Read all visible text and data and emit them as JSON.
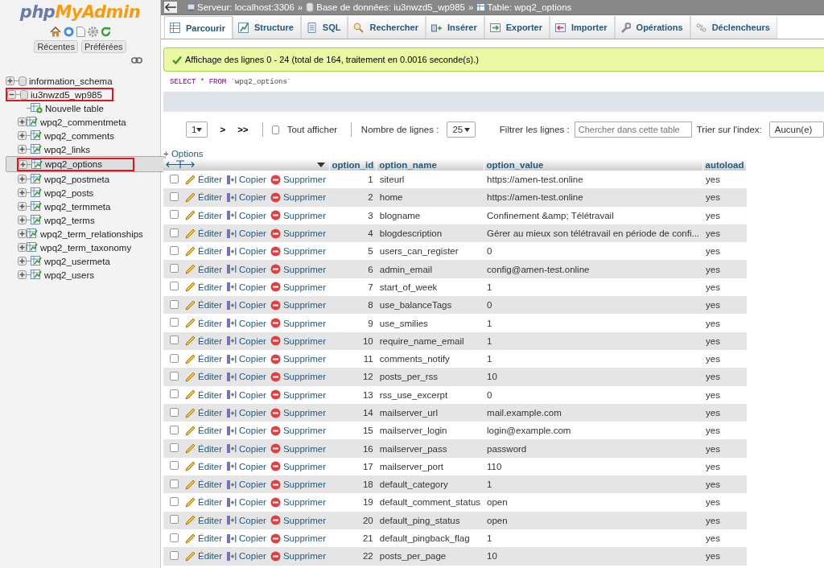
{
  "logo": {
    "part1": "php",
    "part2": "MyAdmin"
  },
  "sidebar_tabs": [
    "Récentes",
    "Préférées"
  ],
  "tree": [
    {
      "label": "information_schema",
      "kind": "database",
      "expanded": false,
      "selected": false,
      "highlighted": false
    },
    {
      "label": "iu3nwzd5_wp985",
      "kind": "database",
      "expanded": true,
      "selected": false,
      "highlighted": true,
      "children": [
        {
          "label": "Nouvelle table",
          "kind": "new",
          "selected": false,
          "highlighted": false
        },
        {
          "label": "wpq2_commentmeta",
          "kind": "table",
          "selected": false,
          "highlighted": false
        },
        {
          "label": "wpq2_comments",
          "kind": "table",
          "selected": false,
          "highlighted": false
        },
        {
          "label": "wpq2_links",
          "kind": "table",
          "selected": false,
          "highlighted": false
        },
        {
          "label": "wpq2_options",
          "kind": "table",
          "selected": true,
          "highlighted": true
        },
        {
          "label": "wpq2_postmeta",
          "kind": "table",
          "selected": false,
          "highlighted": false
        },
        {
          "label": "wpq2_posts",
          "kind": "table",
          "selected": false,
          "highlighted": false
        },
        {
          "label": "wpq2_termmeta",
          "kind": "table",
          "selected": false,
          "highlighted": false
        },
        {
          "label": "wpq2_terms",
          "kind": "table",
          "selected": false,
          "highlighted": false
        },
        {
          "label": "wpq2_term_relationships",
          "kind": "table",
          "selected": false,
          "highlighted": false
        },
        {
          "label": "wpq2_term_taxonomy",
          "kind": "table",
          "selected": false,
          "highlighted": false
        },
        {
          "label": "wpq2_usermeta",
          "kind": "table",
          "selected": false,
          "highlighted": false
        },
        {
          "label": "wpq2_users",
          "kind": "table",
          "selected": false,
          "highlighted": false
        }
      ]
    }
  ],
  "breadcrumb": [
    {
      "kind": "server",
      "label": "Serveur: localhost:3306"
    },
    {
      "kind": "database",
      "separator": "»",
      "label": "Base de données: iu3nwzd5_wp985"
    },
    {
      "kind": "table",
      "separator": "»",
      "label": "Table: wpq2_options"
    }
  ],
  "tabs": [
    {
      "kind": "browse",
      "label": "Parcourir",
      "selected": true
    },
    {
      "kind": "structure",
      "label": "Structure",
      "selected": false
    },
    {
      "kind": "sql",
      "label": "SQL",
      "selected": false
    },
    {
      "kind": "search",
      "label": "Rechercher",
      "selected": false
    },
    {
      "kind": "insert",
      "label": "Insérer",
      "selected": false
    },
    {
      "kind": "export",
      "label": "Exporter",
      "selected": false
    },
    {
      "kind": "import",
      "label": "Importer",
      "selected": false
    },
    {
      "kind": "operations",
      "label": "Opérations",
      "selected": false
    },
    {
      "kind": "triggers",
      "label": "Déclencheurs",
      "selected": false
    }
  ],
  "message": "Affichage des lignes 0 - 24 (total de 164, traitement en 0.0016 seconde(s).)",
  "query": {
    "keyword1": "SELECT",
    "star": "*",
    "keyword2": "FROM",
    "table": "`wpq2_options`"
  },
  "nav": {
    "page": "1",
    "next": ">",
    "last": ">>",
    "show_all": {
      "label": "Tout afficher",
      "checked": false
    },
    "rows_label": "Nombre de lignes :",
    "rows_value": "25",
    "filter_label": "Filtrer les lignes :",
    "filter_placeholder": "Chercher dans cette table",
    "sort_label": "Trier sur l'index:",
    "sort_value": "Aucun(e)"
  },
  "options_link": "+ Options",
  "columns": [
    "option_id",
    "option_name",
    "option_value",
    "autoload"
  ],
  "rows": [
    {
      "checked": false,
      "actions": [
        "Éditer",
        "Copier",
        "Supprimer"
      ],
      "cells": [
        "1",
        "siteurl",
        "https://amen-test.online",
        "yes"
      ]
    },
    {
      "checked": false,
      "actions": [
        "Éditer",
        "Copier",
        "Supprimer"
      ],
      "cells": [
        "2",
        "home",
        "https://amen-test.online",
        "yes"
      ]
    },
    {
      "checked": false,
      "actions": [
        "Éditer",
        "Copier",
        "Supprimer"
      ],
      "cells": [
        "3",
        "blogname",
        "Confinement &amp; Télétravail",
        "yes"
      ]
    },
    {
      "checked": false,
      "actions": [
        "Éditer",
        "Copier",
        "Supprimer"
      ],
      "cells": [
        "4",
        "blogdescription",
        "Gérer au mieux son télétravail en période de confi...",
        "yes"
      ]
    },
    {
      "checked": false,
      "actions": [
        "Éditer",
        "Copier",
        "Supprimer"
      ],
      "cells": [
        "5",
        "users_can_register",
        "0",
        "yes"
      ]
    },
    {
      "checked": false,
      "actions": [
        "Éditer",
        "Copier",
        "Supprimer"
      ],
      "cells": [
        "6",
        "admin_email",
        "config@amen-test.online",
        "yes"
      ]
    },
    {
      "checked": false,
      "actions": [
        "Éditer",
        "Copier",
        "Supprimer"
      ],
      "cells": [
        "7",
        "start_of_week",
        "1",
        "yes"
      ]
    },
    {
      "checked": false,
      "actions": [
        "Éditer",
        "Copier",
        "Supprimer"
      ],
      "cells": [
        "8",
        "use_balanceTags",
        "0",
        "yes"
      ]
    },
    {
      "checked": false,
      "actions": [
        "Éditer",
        "Copier",
        "Supprimer"
      ],
      "cells": [
        "9",
        "use_smilies",
        "1",
        "yes"
      ]
    },
    {
      "checked": false,
      "actions": [
        "Éditer",
        "Copier",
        "Supprimer"
      ],
      "cells": [
        "10",
        "require_name_email",
        "1",
        "yes"
      ]
    },
    {
      "checked": false,
      "actions": [
        "Éditer",
        "Copier",
        "Supprimer"
      ],
      "cells": [
        "11",
        "comments_notify",
        "1",
        "yes"
      ]
    },
    {
      "checked": false,
      "actions": [
        "Éditer",
        "Copier",
        "Supprimer"
      ],
      "cells": [
        "12",
        "posts_per_rss",
        "10",
        "yes"
      ]
    },
    {
      "checked": false,
      "actions": [
        "Éditer",
        "Copier",
        "Supprimer"
      ],
      "cells": [
        "13",
        "rss_use_excerpt",
        "0",
        "yes"
      ]
    },
    {
      "checked": false,
      "actions": [
        "Éditer",
        "Copier",
        "Supprimer"
      ],
      "cells": [
        "14",
        "mailserver_url",
        "mail.example.com",
        "yes"
      ]
    },
    {
      "checked": false,
      "actions": [
        "Éditer",
        "Copier",
        "Supprimer"
      ],
      "cells": [
        "15",
        "mailserver_login",
        "login@example.com",
        "yes"
      ]
    },
    {
      "checked": false,
      "actions": [
        "Éditer",
        "Copier",
        "Supprimer"
      ],
      "cells": [
        "16",
        "mailserver_pass",
        "password",
        "yes"
      ]
    },
    {
      "checked": false,
      "actions": [
        "Éditer",
        "Copier",
        "Supprimer"
      ],
      "cells": [
        "17",
        "mailserver_port",
        "110",
        "yes"
      ]
    },
    {
      "checked": false,
      "actions": [
        "Éditer",
        "Copier",
        "Supprimer"
      ],
      "cells": [
        "18",
        "default_category",
        "1",
        "yes"
      ]
    },
    {
      "checked": false,
      "actions": [
        "Éditer",
        "Copier",
        "Supprimer"
      ],
      "cells": [
        "19",
        "default_comment_status",
        "open",
        "yes"
      ]
    },
    {
      "checked": false,
      "actions": [
        "Éditer",
        "Copier",
        "Supprimer"
      ],
      "cells": [
        "20",
        "default_ping_status",
        "open",
        "yes"
      ]
    },
    {
      "checked": false,
      "actions": [
        "Éditer",
        "Copier",
        "Supprimer"
      ],
      "cells": [
        "21",
        "default_pingback_flag",
        "1",
        "yes"
      ]
    },
    {
      "checked": false,
      "actions": [
        "Éditer",
        "Copier",
        "Supprimer"
      ],
      "cells": [
        "22",
        "posts_per_page",
        "10",
        "yes"
      ]
    }
  ]
}
